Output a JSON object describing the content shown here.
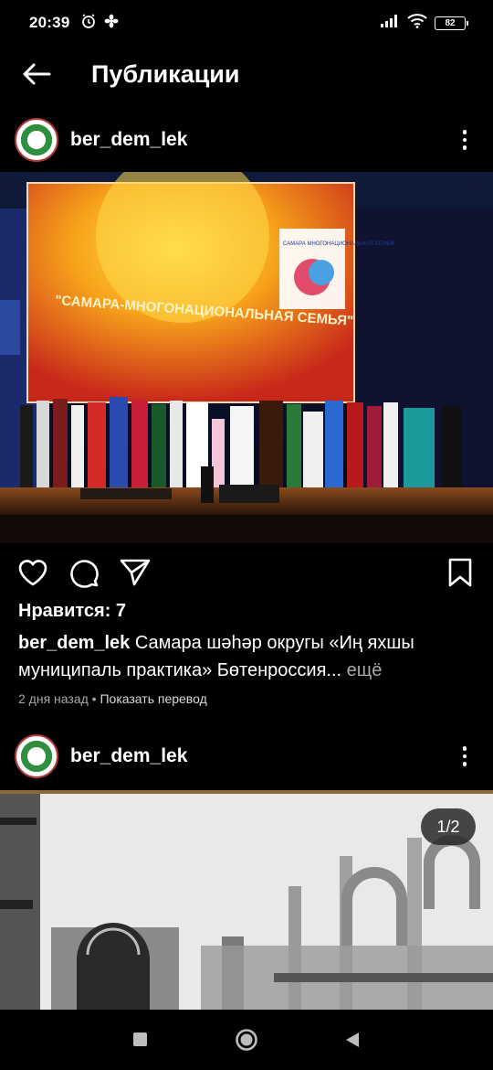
{
  "status_bar": {
    "time": "20:39",
    "battery": "82",
    "icons": [
      "alarm-icon",
      "fan-icon",
      "signal-icon",
      "wifi-icon",
      "battery-icon"
    ]
  },
  "header": {
    "title": "Публикации",
    "back_icon": "arrow-left-icon"
  },
  "posts": [
    {
      "username": "ber_dem_lek",
      "image_text": {
        "banner_main": "\"САМАРА-МНОГОНАЦИОНАЛЬНАЯ СЕМЬЯ\"",
        "banner_logo": "САМАРА МНОГОНАЦИОНАЛЬНАЯ СЕМЬЯ"
      },
      "likes": "Нравится: 7",
      "caption_user": "ber_dem_lek",
      "caption_text": "Самара шәһәр округы «Иң яхшы муниципаль практика» Бөтенроссия",
      "caption_ellipsis": "...",
      "caption_more": "ещё",
      "time_ago": "2 дня назад",
      "separator": " • ",
      "translate": "Показать перевод"
    },
    {
      "username": "ber_dem_lek",
      "image_counter": "1/2"
    }
  ],
  "colors": {
    "background": "#000000",
    "secondary_text": "#a8a8a8",
    "avatar_border": "#b23a3a",
    "avatar_green": "#2f8f3f"
  }
}
